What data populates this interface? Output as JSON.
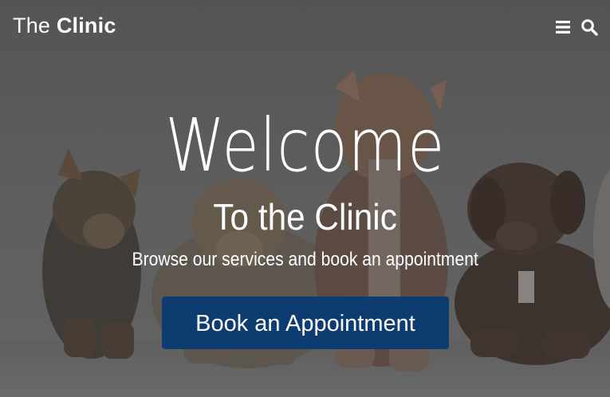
{
  "header": {
    "brand_light": "The",
    "brand_bold": "Clinic"
  },
  "hero": {
    "title": "Welcome",
    "subtitle": "To the Clinic",
    "tagline": "Browse our services and book an appointment",
    "cta_label": "Book an Appointment"
  },
  "icons": {
    "menu": "hamburger-menu-icon",
    "search": "search-icon"
  },
  "colors": {
    "overlay": "#5a5a5a",
    "cta_background": "#0d3d70",
    "text": "#ffffff"
  }
}
